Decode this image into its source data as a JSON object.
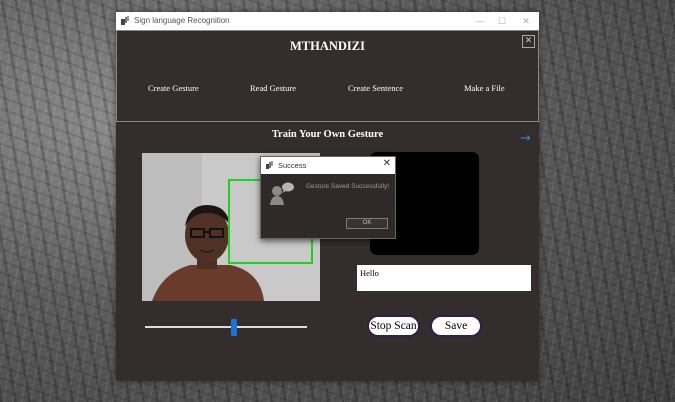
{
  "window": {
    "title": "Sign language Recognition",
    "controls": {
      "minimize": "—",
      "maximize": "☐",
      "close": "✕"
    }
  },
  "header": {
    "brand": "MTHANDIZI",
    "close_glyph": "✕",
    "menu": [
      {
        "label": "Create Gesture"
      },
      {
        "label": "Read Gesture"
      },
      {
        "label": "Create Sentence"
      },
      {
        "label": "Make a File"
      }
    ]
  },
  "main": {
    "section_title": "Train Your Own Gesture",
    "next_arrow": "→",
    "text_output": "Hello",
    "slider_value": 0.55,
    "stop_scan_label": "Stop Scan",
    "save_label": "Save"
  },
  "dialog": {
    "title": "Success",
    "close_glyph": "✕",
    "message": "Gesture Saved Successfully!",
    "ok_label": "OK"
  },
  "colors": {
    "window_bg": "#342d2d",
    "roi_box": "#22d022",
    "slider_thumb": "#1a73d6",
    "arrow": "#2e86d9"
  },
  "icons": {
    "app": "hand-sign-icon",
    "dialog_message": "info-chat-icon"
  }
}
